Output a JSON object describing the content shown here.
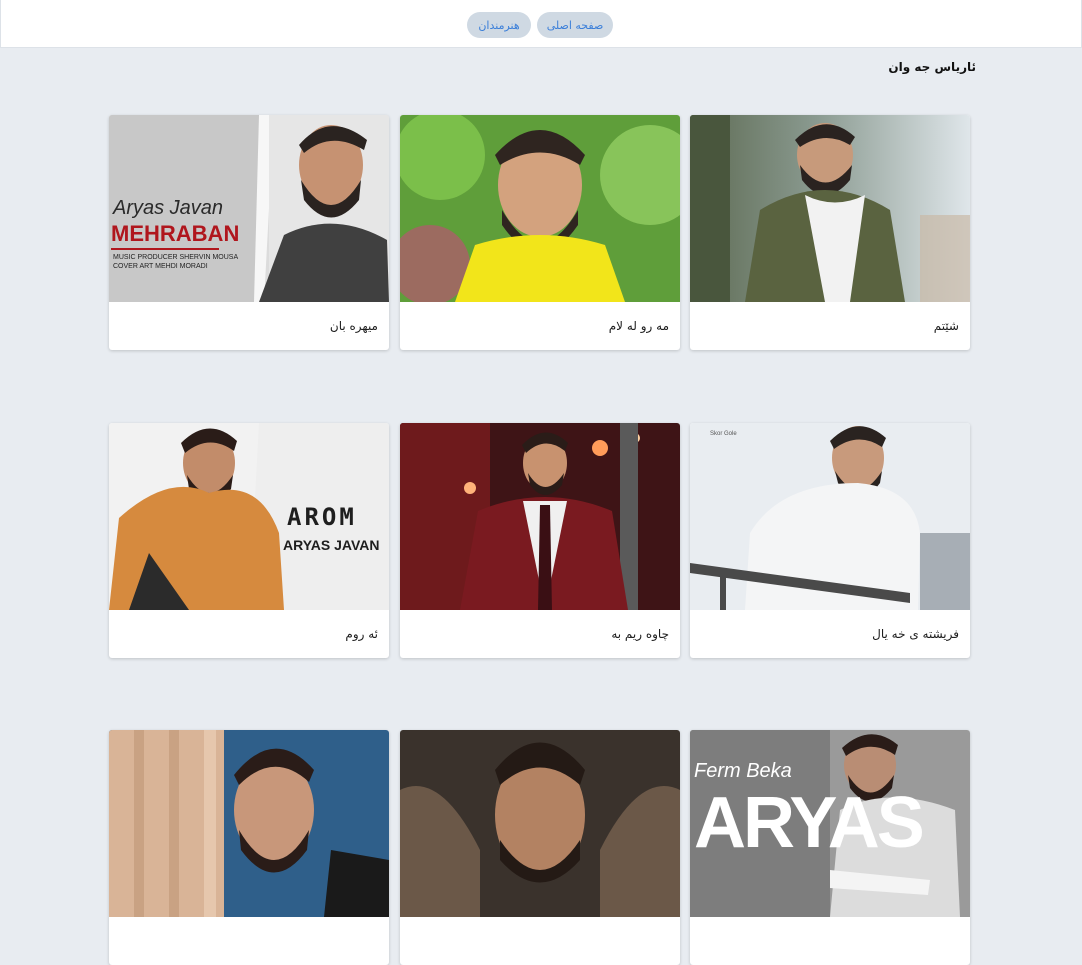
{
  "nav": {
    "home_label": "صفحه اصلی",
    "artists_label": "هنرمندان"
  },
  "page_title": "ئاریاس جه وان",
  "cards": [
    {
      "title": "شێتم"
    },
    {
      "title": "مه رو له لام"
    },
    {
      "title": "میهره بان",
      "cover_text": {
        "script": "Aryas Javan",
        "big": "MEHRABAN",
        "credit1": "MUSIC PRODUCER SHERVIN MOUSA",
        "credit2": "COVER ART MEHDI MORADI"
      }
    },
    {
      "title": "فریشته ی خه یال",
      "cover_text": {
        "small": "Skor Gole"
      }
    },
    {
      "title": "چاوه ریم به"
    },
    {
      "title": "ئه روم",
      "cover_text": {
        "big": "AROM",
        "sub": "ARYAS JAVAN"
      }
    },
    {
      "title": "",
      "cover_text": {
        "script": "Ferm Beka",
        "big": "ARYAS"
      }
    },
    {
      "title": ""
    },
    {
      "title": ""
    }
  ],
  "colors": {
    "background": "#e8ecf1",
    "pill_bg": "#cfd9e3",
    "pill_text": "#3b7fd9"
  }
}
